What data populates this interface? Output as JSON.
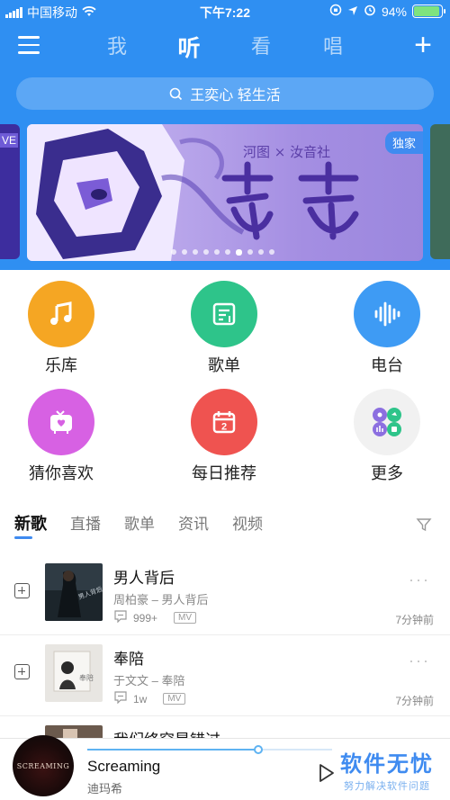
{
  "status_bar": {
    "carrier": "中国移动",
    "time": "下午7:22",
    "battery": "94%",
    "battery_level": 0.94
  },
  "nav": {
    "tabs": [
      {
        "label": "我"
      },
      {
        "label": "听"
      },
      {
        "label": "看"
      },
      {
        "label": "唱"
      }
    ],
    "active_tab": "听"
  },
  "search": {
    "placeholder": "王奕心 轻生活"
  },
  "banner": {
    "badge": "独家",
    "title": "河图 × 汝音社",
    "side_tag": "VE",
    "dot_count": 10,
    "active_dot": 6
  },
  "grid": [
    {
      "label": "乐库",
      "icon": "music-note-icon",
      "color": "#f5a623"
    },
    {
      "label": "歌单",
      "icon": "playlist-icon",
      "color": "#2ec48a"
    },
    {
      "label": "电台",
      "icon": "radio-wave-icon",
      "color": "#3e9bf4"
    },
    {
      "label": "猜你喜欢",
      "icon": "heart-tv-icon",
      "color": "#d761e3"
    },
    {
      "label": "每日推荐",
      "icon": "calendar-icon",
      "color": "#ef5350"
    },
    {
      "label": "更多",
      "icon": "more-apps-icon",
      "color": "#f1f1f1"
    }
  ],
  "tabs": {
    "items": [
      {
        "label": "新歌"
      },
      {
        "label": "直播"
      },
      {
        "label": "歌单"
      },
      {
        "label": "资讯"
      },
      {
        "label": "视频"
      }
    ],
    "active": "新歌"
  },
  "songs": [
    {
      "title": "男人背后",
      "artist": "周柏豪 – 男人背后",
      "comments": "999+",
      "mv": "MV",
      "time": "7分钟前"
    },
    {
      "title": "奉陪",
      "artist": "于文文 – 奉陪",
      "comments": "1w",
      "mv": "MV",
      "time": "7分钟前"
    },
    {
      "title": "我们终究是错过",
      "artist": "",
      "comments": "",
      "mv": "",
      "time": ""
    }
  ],
  "player": {
    "cover_text": "SCREAMING",
    "song": "Screaming",
    "artist": "迪玛希",
    "progress": 0.7
  },
  "watermark": {
    "title": "软件无忧",
    "subtitle": "努力解决软件问题"
  },
  "colors": {
    "primary": "#2f8ff2",
    "accent": "#3f8bf0"
  }
}
